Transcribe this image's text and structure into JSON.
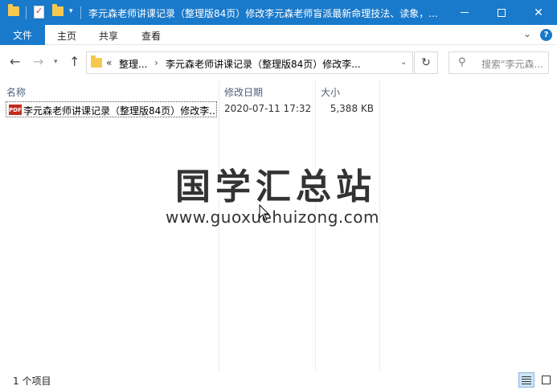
{
  "window": {
    "title": "李元森老师讲课记录（整理版84页）修改李元森老师盲派最新命理技法、读象，..."
  },
  "ribbon": {
    "tabs": [
      "文件",
      "主页",
      "共享",
      "查看"
    ]
  },
  "address": {
    "overflow": "«",
    "crumbs": [
      "整理...",
      "李元森老师讲课记录（整理版84页）修改李..."
    ]
  },
  "search": {
    "placeholder": "搜索\"李元森..."
  },
  "columns": {
    "name": "名称",
    "date": "修改日期",
    "size": "大小"
  },
  "files": [
    {
      "icon": "pdf-icon",
      "name": "李元森老师讲课记录（整理版84页）修改李...",
      "modified": "2020-07-11 17:32",
      "size": "5,388 KB"
    }
  ],
  "watermark": {
    "title": "国学汇总站",
    "url": "www.guoxuehuizong.com"
  },
  "status": {
    "item_count": "1 个项目"
  },
  "colors": {
    "accent": "#1979ca",
    "folder": "#f6c94e",
    "pdf": "#c42b1c"
  }
}
